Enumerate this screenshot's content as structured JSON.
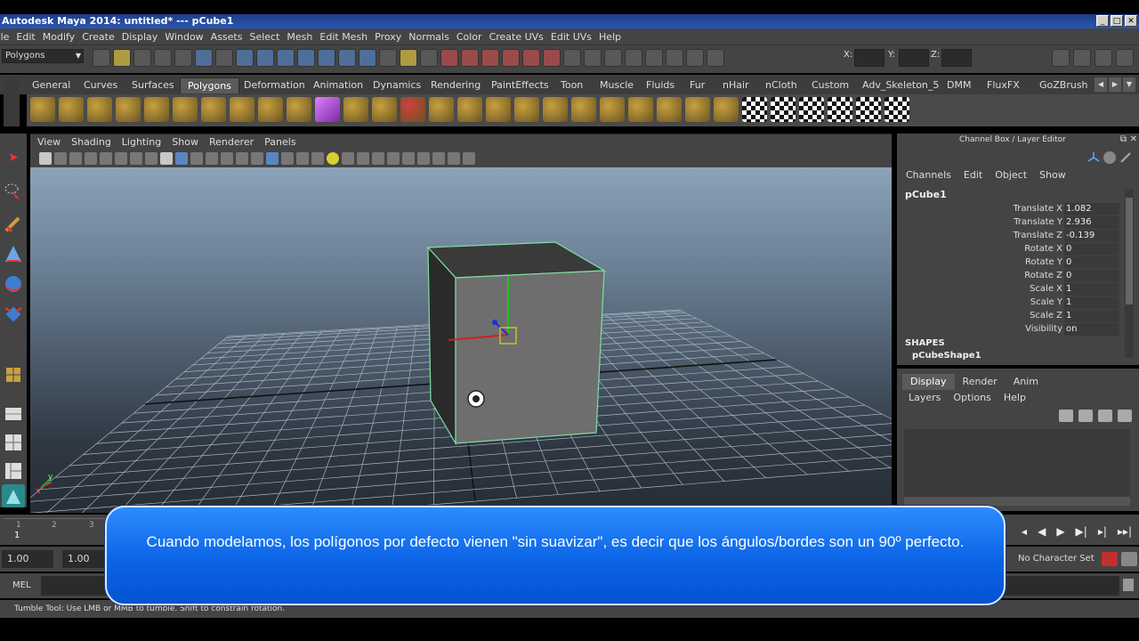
{
  "window": {
    "title": "Autodesk Maya 2014: untitled*  ---  pCube1",
    "controls": [
      "_",
      "□",
      "✕"
    ]
  },
  "menubar": [
    "File",
    "Edit",
    "Modify",
    "Create",
    "Display",
    "Window",
    "Assets",
    "Select",
    "Mesh",
    "Edit Mesh",
    "Proxy",
    "Normals",
    "Color",
    "Create UVs",
    "Edit UVs",
    "Help"
  ],
  "statusline": {
    "mode": "Polygons",
    "x_label": "X:",
    "y_label": "Y:",
    "z_label": "Z:"
  },
  "shelf": {
    "tabs": [
      "General",
      "Curves",
      "Surfaces",
      "Polygons",
      "Deformation",
      "Animation",
      "Dynamics",
      "Rendering",
      "PaintEffects",
      "Toon",
      "Muscle",
      "Fluids",
      "Fur",
      "nHair",
      "nCloth",
      "Custom",
      "Adv_Skeleton_5",
      "DMM",
      "FluxFX",
      "GoZBrush"
    ],
    "active_tab": "Polygons"
  },
  "viewport": {
    "menu": [
      "View",
      "Shading",
      "Lighting",
      "Show",
      "Renderer",
      "Panels"
    ],
    "axis_y": "y",
    "axis_x": "x"
  },
  "channel_box": {
    "title": "Channel Box / Layer Editor",
    "menu": [
      "Channels",
      "Edit",
      "Object",
      "Show"
    ],
    "object_name": "pCube1",
    "attributes": [
      {
        "label": "Translate X",
        "value": "1.082"
      },
      {
        "label": "Translate Y",
        "value": "2.936"
      },
      {
        "label": "Translate Z",
        "value": "-0.139"
      },
      {
        "label": "Rotate X",
        "value": "0"
      },
      {
        "label": "Rotate Y",
        "value": "0"
      },
      {
        "label": "Rotate Z",
        "value": "0"
      },
      {
        "label": "Scale X",
        "value": "1"
      },
      {
        "label": "Scale Y",
        "value": "1"
      },
      {
        "label": "Scale Z",
        "value": "1"
      },
      {
        "label": "Visibility",
        "value": "on"
      }
    ],
    "shapes_label": "SHAPES",
    "shape_name": "pCubeShape1"
  },
  "layer_editor": {
    "tabs": [
      "Display",
      "Render",
      "Anim"
    ],
    "active_tab": "Display",
    "menu": [
      "Layers",
      "Options",
      "Help"
    ]
  },
  "timeline": {
    "current_frame": "1",
    "ruler_labels": [
      "1",
      "2",
      "3"
    ],
    "playback_icons": [
      "◂",
      "◀",
      "▶",
      "▶|",
      "▸|",
      "▸▸|"
    ]
  },
  "range": {
    "start": "1.00",
    "playback_start": "1.00",
    "character_set": "No Character Set"
  },
  "commandline": {
    "label": "MEL"
  },
  "helpline": {
    "text": "Tumble Tool: Use LMB or MMB to tumble. Shift to constrain rotation."
  },
  "subtitle": {
    "text": "Cuando modelamos, los polígonos por defecto vienen \"sin suavizar\", es decir que los ángulos/bordes son un 90º perfecto."
  }
}
